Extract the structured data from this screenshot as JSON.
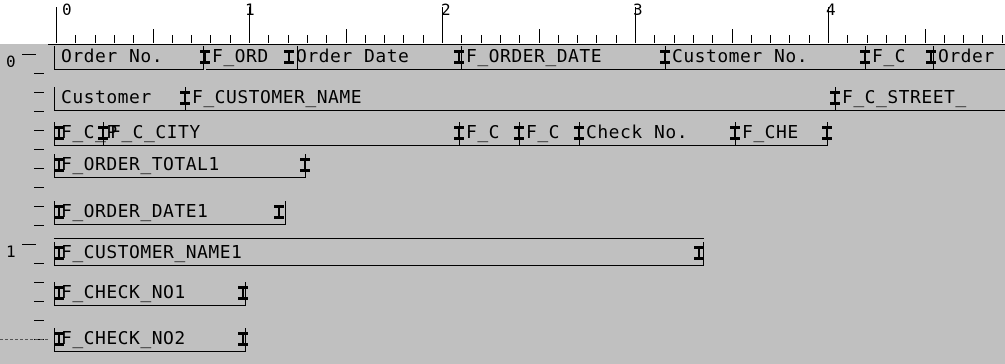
{
  "ruler": {
    "h_numbers": [
      "0",
      "1",
      "2",
      "3",
      "4"
    ],
    "v_numbers": [
      "0",
      "1"
    ]
  },
  "fields": {
    "order_no_label": "Order No.",
    "order_no_value": "F_ORD",
    "order_date_label": "Order Date",
    "order_date_value": "F_ORDER_DATE",
    "customer_no_label": "Customer No.",
    "customer_no_value": "F_C",
    "order_label_cut": "Order",
    "customer_label": "Customer",
    "customer_name": "F_CUSTOMER_NAME",
    "c_street": "F_C_STREET_",
    "c_p": "F_C_P",
    "c_city": "F_C_CITY",
    "c_a": "F_C",
    "c_b": "F_C",
    "check_no_label": "Check No.",
    "check_no_value": "F_CHE",
    "order_total1": "F_ORDER_TOTAL1",
    "order_date1": "F_ORDER_DATE1",
    "customer_name1": "F_CUSTOMER_NAME1",
    "check_no1": "F_CHECK_NO1",
    "check_no2": "F_CHECK_NO2"
  }
}
